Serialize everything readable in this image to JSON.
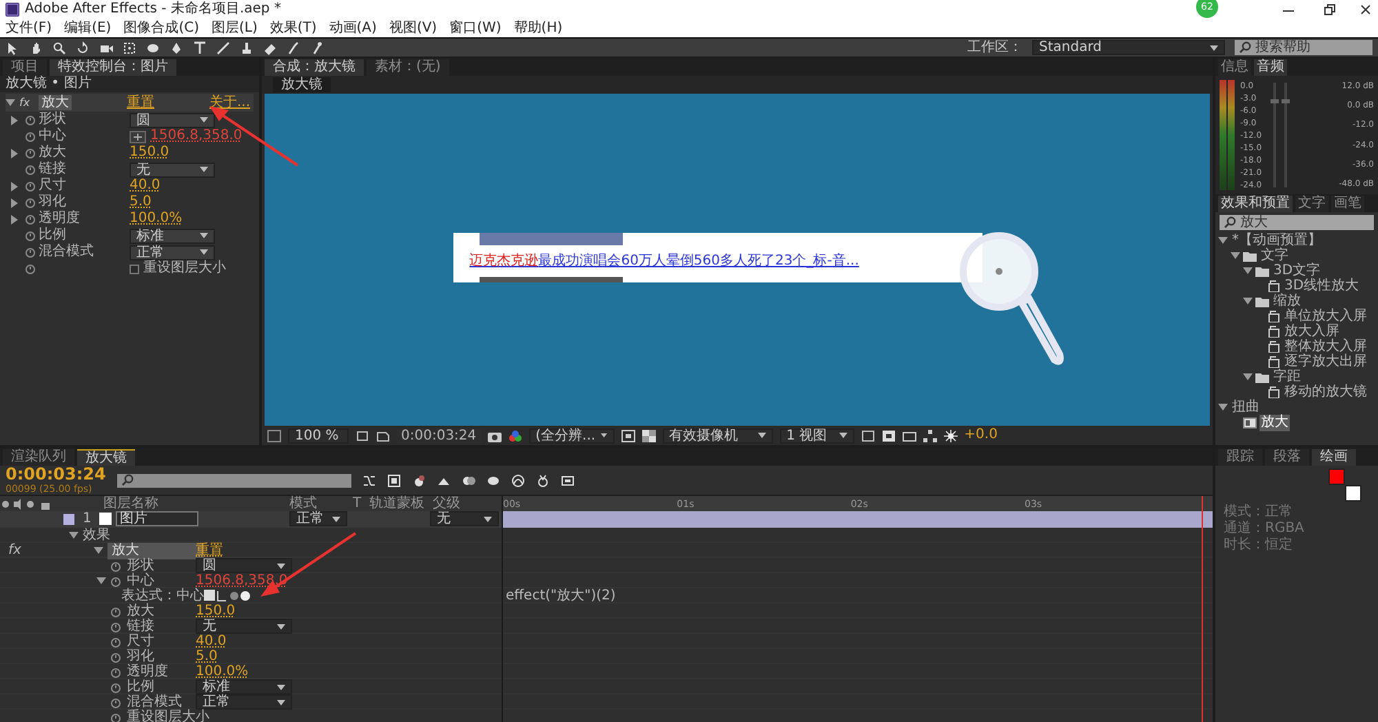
{
  "window": {
    "title": "Adobe After Effects - 未命名项目.aep *",
    "badge": "62"
  },
  "menu": [
    "文件(F)",
    "编辑(E)",
    "图像合成(C)",
    "图层(L)",
    "效果(T)",
    "动画(A)",
    "视图(V)",
    "窗口(W)",
    "帮助(H)"
  ],
  "toolbar": {
    "workspace_label": "工作区：",
    "workspace": "Standard",
    "search_placeholder": "搜索帮助"
  },
  "effect_controls": {
    "tabs": [
      {
        "label": "项目",
        "selected": false
      },
      {
        "label": "特效控制台：图片",
        "selected": true
      }
    ],
    "header": "放大镜 • 图片",
    "effect": {
      "fx": "fx",
      "name": "放大",
      "reset": "重置",
      "about": "关于..."
    },
    "properties": [
      {
        "kind": "dropdown",
        "name": "形状",
        "value": "圆",
        "expanded": false
      },
      {
        "kind": "point",
        "name": "中心",
        "value": "1506.8,358.0"
      },
      {
        "kind": "number",
        "name": "放大",
        "value": "150.0",
        "expanded": false
      },
      {
        "kind": "dropdown",
        "name": "链接",
        "value": "无"
      },
      {
        "kind": "number",
        "name": "尺寸",
        "value": "40.0",
        "expanded": false
      },
      {
        "kind": "number",
        "name": "羽化",
        "value": "5.0",
        "expanded": false
      },
      {
        "kind": "number",
        "name": "透明度",
        "value": "100.0%",
        "expanded": false
      },
      {
        "kind": "dropdown",
        "name": "比例",
        "value": "标准"
      },
      {
        "kind": "dropdown",
        "name": "混合模式",
        "value": "正常"
      },
      {
        "kind": "checkbox",
        "value": "重设图层大小",
        "checked": false
      }
    ]
  },
  "composition": {
    "tabs": [
      {
        "label": "合成：放大镜",
        "selected": true
      },
      {
        "label": "素材：(无)",
        "selected": false
      }
    ],
    "view_tab": "放大镜",
    "headline": {
      "highlight": "迈克杰克逊",
      "rest": "最成功演唱会60万人晕倒560多人死了23个_标-音..."
    },
    "footer": {
      "zoom": "100 %",
      "time": "0:00:03:24",
      "resolution": "(全分辨...",
      "camera": "有效摄像机",
      "views": "1 视图",
      "exposure": "+0.0"
    }
  },
  "audio": {
    "tabs": [
      {
        "label": "信息",
        "selected": false
      },
      {
        "label": "音频",
        "selected": true
      }
    ],
    "meter_labels": [
      "0.0",
      "-3.0",
      "-6.0",
      "-9.0",
      "-12.0",
      "-15.0",
      "-18.0",
      "-21.0",
      "-24.0"
    ],
    "db_labels": [
      "12.0 dB",
      "0.0 dB",
      "-12.0",
      "-24.0",
      "-36.0",
      "-48.0 dB"
    ]
  },
  "presets": {
    "tabs": [
      {
        "label": "效果和预置",
        "selected": true
      },
      {
        "label": "文字",
        "selected": false
      },
      {
        "label": "画笔",
        "selected": false
      }
    ],
    "search": "放大",
    "tree": [
      {
        "label": "*【动画预置】",
        "expanded": true,
        "selected": false,
        "children": [
          {
            "kind": "folder",
            "label": "文字",
            "expanded": true,
            "selected": false,
            "children": [
              {
                "kind": "folder",
                "label": "3D文字",
                "expanded": true,
                "selected": false,
                "children": [
                  {
                    "kind": "preset",
                    "label": "3D线性放大",
                    "selected": false
                  }
                ]
              },
              {
                "kind": "folder",
                "label": "缩放",
                "expanded": true,
                "selected": false,
                "children": [
                  {
                    "kind": "preset",
                    "label": "单位放大入屏",
                    "selected": false
                  },
                  {
                    "kind": "preset",
                    "label": "放大入屏",
                    "selected": false
                  },
                  {
                    "kind": "preset",
                    "label": "整体放大入屏",
                    "selected": false
                  },
                  {
                    "kind": "preset",
                    "label": "逐字放大出屏",
                    "selected": false
                  }
                ]
              },
              {
                "kind": "folder",
                "label": "字距",
                "expanded": true,
                "selected": false,
                "children": [
                  {
                    "kind": "preset",
                    "label": "移动的放大镜",
                    "selected": false
                  }
                ]
              }
            ]
          }
        ]
      },
      {
        "label": "扭曲",
        "expanded": true,
        "selected": false,
        "children": [
          {
            "kind": "effect",
            "label": "放大",
            "selected": true
          }
        ]
      }
    ]
  },
  "timeline": {
    "tabs": [
      {
        "label": "渲染队列",
        "selected": false
      },
      {
        "label": "放大镜",
        "selected": true
      }
    ],
    "time": "0:00:03:24",
    "frames": "00099 (25.00 fps)",
    "columns": [
      "图层名称",
      "模式",
      "T",
      "轨道蒙板",
      "父级"
    ],
    "layer": {
      "index": "1",
      "name": "图片",
      "mode": "正常",
      "parent": "无"
    },
    "ruler": [
      "00s",
      "01s",
      "02s",
      "03s"
    ],
    "playhead": {
      "level": 0.985
    },
    "rows": [
      {
        "kind": "group",
        "name": "效果",
        "expanded": true
      },
      {
        "kind": "effect",
        "fx": "fx",
        "name": "放大",
        "value": "重置",
        "expanded": true
      },
      {
        "kind": "dropdown",
        "name": "形状",
        "value": "圆"
      },
      {
        "kind": "point",
        "name": "中心",
        "value": "1506.8,358.0",
        "expanded": true
      },
      {
        "kind": "expression",
        "name": "表达式：中心",
        "value": "effect(\"放大\")(2)"
      },
      {
        "kind": "number",
        "name": "放大",
        "value": "150.0"
      },
      {
        "kind": "dropdown",
        "name": "链接",
        "value": "无"
      },
      {
        "kind": "number",
        "name": "尺寸",
        "value": "40.0"
      },
      {
        "kind": "number",
        "name": "羽化",
        "value": "5.0"
      },
      {
        "kind": "number",
        "name": "透明度",
        "value": "100.0%"
      },
      {
        "kind": "dropdown",
        "name": "比例",
        "value": "标准"
      },
      {
        "kind": "dropdown",
        "name": "混合模式",
        "value": "正常"
      },
      {
        "kind": "label",
        "name": "重设图层大小"
      }
    ]
  },
  "paint": {
    "tabs": [
      {
        "label": "跟踪",
        "selected": false
      },
      {
        "label": "段落",
        "selected": false
      },
      {
        "label": "绘画",
        "selected": true
      }
    ],
    "rows": [
      "模式：正常",
      "通道：RGBA",
      "时长：恒定"
    ]
  }
}
